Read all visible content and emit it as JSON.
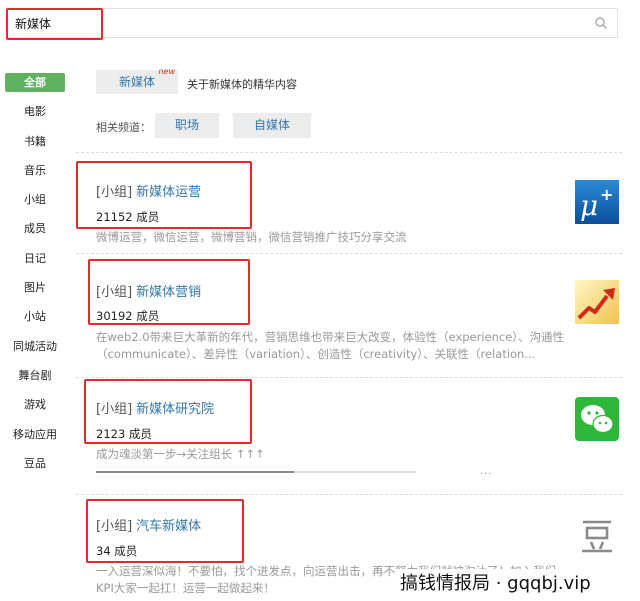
{
  "search": {
    "value": "新媒体"
  },
  "sidebar": {
    "items": [
      {
        "label": "全部",
        "active": true
      },
      {
        "label": "电影"
      },
      {
        "label": "书籍"
      },
      {
        "label": "音乐"
      },
      {
        "label": "小组"
      },
      {
        "label": "成员"
      },
      {
        "label": "日记"
      },
      {
        "label": "图片"
      },
      {
        "label": "小站"
      },
      {
        "label": "同城活动"
      },
      {
        "label": "舞台剧"
      },
      {
        "label": "游戏"
      },
      {
        "label": "移动应用"
      },
      {
        "label": "豆品"
      }
    ]
  },
  "topic": {
    "tag": "新媒体",
    "badge": "new",
    "desc": "关于新媒体的精华内容"
  },
  "related": {
    "label": "相关频道：",
    "chips": [
      "职场",
      "自媒体"
    ]
  },
  "groups": [
    {
      "prefix": "[小组]",
      "name": "新媒体运营",
      "members": "21152 成员",
      "desc": "微博运营，微信运营，微博营销，微信营销推广技巧分享交流",
      "icon": "mu-plus-icon"
    },
    {
      "prefix": "[小组]",
      "name": "新媒体营销",
      "members": "30192 成员",
      "desc": "在web2.0带来巨大革新的年代，营销思维也带来巨大改变，体验性（experience）、沟通性（communicate）、差异性（variation）、创造性（creativity）、关联性（relation...",
      "icon": "growth-arrow-icon"
    },
    {
      "prefix": "[小组]",
      "name": "新媒体研究院",
      "members": "2123 成员",
      "desc": "成为魂淡第一步→关注组长 ↑↑↑",
      "icon": "wechat-icon"
    },
    {
      "prefix": "[小组]",
      "name": "汽车新媒体",
      "members": "34 成员",
      "desc": "一入运营深似海！不要怕，找个进发点，向运营出击，再不努力我们就被淘汰了！加入我们KPI大家一起扛！运营一起做起来！",
      "icon": "douban-icon"
    }
  ],
  "progress": {
    "fraction": 0.62
  },
  "dots": "...",
  "watermark": "搞钱情报局 · gqqbj.vip",
  "colors": {
    "accent_green": "#5fb360",
    "link_blue": "#3377aa",
    "highlight_red": "#e22b2b"
  }
}
